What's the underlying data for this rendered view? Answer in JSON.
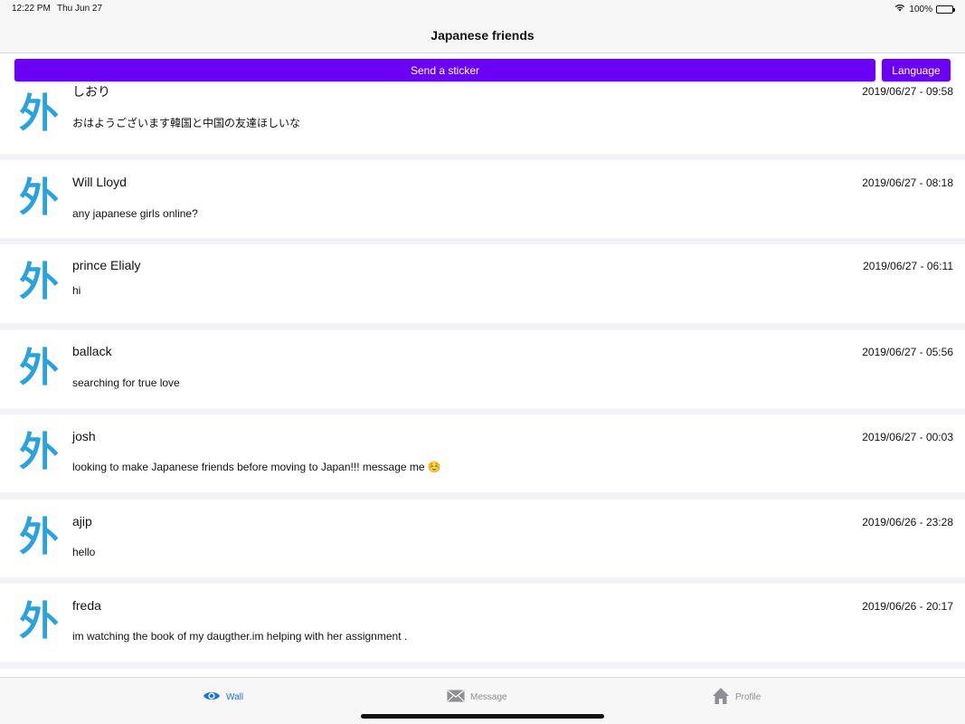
{
  "status": {
    "time": "12:22 PM",
    "date": "Thu Jun 27",
    "battery": "100%"
  },
  "nav": {
    "title": "Japanese friends"
  },
  "actions": {
    "send_sticker": "Send a sticker",
    "language": "Language",
    "button_color": "#6a00f4"
  },
  "avatar_glyph": "外",
  "posts": [
    {
      "name": "しおり",
      "time": "2019/06/27 - 09:58",
      "message": "おはようございます韓国と中国の友達ほしいな"
    },
    {
      "name": "Will Lloyd",
      "time": "2019/06/27 - 08:18",
      "message": "any japanese girls online?"
    },
    {
      "name": "prince Elialy",
      "time": "2019/06/27 - 06:11",
      "message": "hi"
    },
    {
      "name": "ballack",
      "time": "2019/06/27 - 05:56",
      "message": "searching for true love"
    },
    {
      "name": "josh",
      "time": "2019/06/27 - 00:03",
      "message": "looking to make Japanese friends before moving to Japan!!! message me ☺️"
    },
    {
      "name": "ajip",
      "time": "2019/06/26 - 23:28",
      "message": "hello"
    },
    {
      "name": "freda",
      "time": "2019/06/26 - 20:17",
      "message": "im watching the book of my daugther.im helping with her assignment ."
    }
  ],
  "tabs": {
    "wall": "Wall",
    "message": "Message",
    "profile": "Profile",
    "active_color": "#1a73e8"
  }
}
